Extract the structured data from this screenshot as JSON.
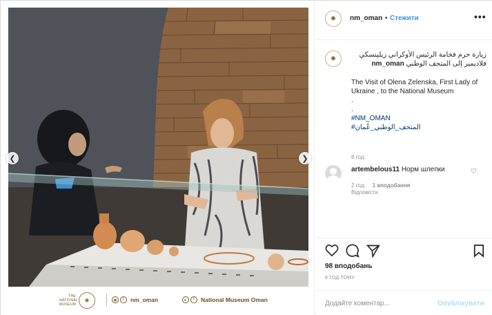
{
  "header": {
    "username": "nm_oman",
    "separator": "•",
    "follow_label": "Стежити",
    "more_icon": "more-options-icon"
  },
  "caption": {
    "username": "nm_oman",
    "arabic_line": "زيارة حرم فخامة الرئيس الأوكراني زيلينسكي فلاديمير إلى المتحف الوطني",
    "english_line": "The Visit of Olena Zelenska, First Lady of Ukraine , to the National Museum",
    "dot1": ".",
    "dot2": ".",
    "hashtag1": "#NM_OMAN",
    "hashtag2": "#المتحف_الوطني_عُمان",
    "time": "8 год."
  },
  "reply": {
    "username": "artembelous11",
    "text": "Норм шлепки",
    "time": "2 год.",
    "likes": "1 вподобання",
    "reply_label": "Відповісти"
  },
  "actions": {
    "likes_count": "98 вподобань",
    "post_time": "8 ГОД ТОМУ"
  },
  "add_comment": {
    "placeholder": "Додайте коментар...",
    "publish_label": "Опублікувати"
  },
  "photo_footer": {
    "logo_text": "THE NATIONAL MUSEUM",
    "handle": "nm_oman",
    "museum_name": "National Museum Oman"
  },
  "colors": {
    "link_blue": "#3897f0",
    "publish_disabled": "#b2dffc",
    "hashtag": "#003569",
    "meta_gray": "#8e8e8e"
  }
}
